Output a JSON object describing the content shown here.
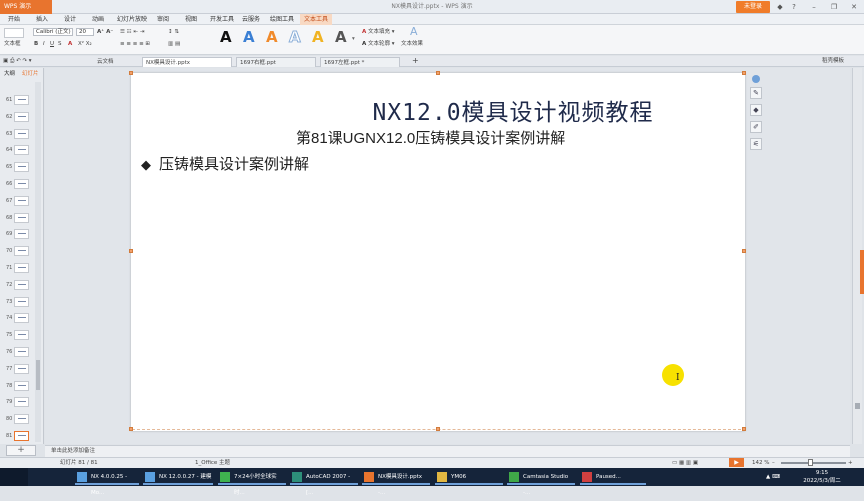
{
  "titlebar": {
    "app_button": "WPS 演示",
    "title": "NX模具设计.pptx - WPS 演示",
    "login": "未登录",
    "controls": [
      "◆",
      "?",
      "–",
      "❐",
      "✕"
    ]
  },
  "menu": {
    "items": [
      "开始",
      "插入",
      "设计",
      "动画",
      "幻灯片放映",
      "审阅",
      "视图",
      "开发工具",
      "云服务",
      "绘图工具",
      "文本工具"
    ],
    "active_index": 10
  },
  "ribbon": {
    "text_layout": "文本框",
    "font_name": "Calibri (正文)",
    "font_size": "20",
    "text_fill": "文本填充",
    "text_outline": "文本轮廓",
    "text_effect": "文本效果",
    "text_style_glyph": "A",
    "text_style_colors": [
      "#111111",
      "#3a7fd4",
      "#f08a2b",
      "#8aaed8",
      "#f0b323",
      "#555555"
    ]
  },
  "tabs": {
    "home": "云文档",
    "items": [
      "NX模具设计.pptx",
      "1697右框.ppt",
      "1697左框.ppt *"
    ],
    "active_index": 0,
    "right": "稻壳模板"
  },
  "left_panel": {
    "tabs": [
      "大纲",
      "幻灯片"
    ],
    "thumbnails": [
      "61",
      "62",
      "63",
      "64",
      "65",
      "66",
      "67",
      "68",
      "69",
      "70",
      "71",
      "72",
      "73",
      "74",
      "75",
      "76",
      "77",
      "78",
      "79",
      "80",
      "81"
    ],
    "selected": "81"
  },
  "slide": {
    "title": "NX12.0模具设计视频教程",
    "subtitle": "第81课UGNX12.0压铸模具设计案例讲解",
    "bullet_symbol": "◆",
    "bullet": "压铸模具设计案例讲解"
  },
  "notes": {
    "placeholder": "单击此处添加备注"
  },
  "status": {
    "slide_index": "幻灯片 81 / 81",
    "theme": "1_Office 主题",
    "zoom": "142 %",
    "zoom_fraction": 0.45
  },
  "taskbar": {
    "items": [
      {
        "label": "NX 4.0.0.25 - Mo...",
        "icon": "nx-icon",
        "color": "#5aa0e0"
      },
      {
        "label": "NX 12.0.0.27 - 建模",
        "icon": "nx-icon",
        "color": "#5aa0e0"
      },
      {
        "label": "7×24小时全球实时...",
        "icon": "news-icon",
        "color": "#3fb24f"
      },
      {
        "label": "AutoCAD 2007 - [...",
        "icon": "autocad-icon",
        "color": "#2d8f7a"
      },
      {
        "label": "NX模具设计.pptx -...",
        "icon": "wps-icon",
        "color": "#e8742e"
      },
      {
        "label": "YM06",
        "icon": "folder-icon",
        "color": "#e2b742"
      },
      {
        "label": "Camtasia Studio -...",
        "icon": "camtasia-icon",
        "color": "#3fa848"
      },
      {
        "label": "Paused...",
        "icon": "recorder-icon",
        "color": "#d04040"
      }
    ],
    "time": "9:15",
    "date": "2022/5/3/周二"
  }
}
